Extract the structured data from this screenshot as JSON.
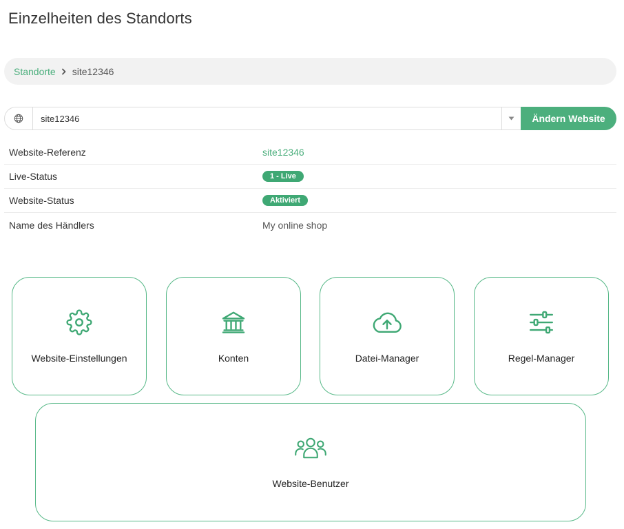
{
  "page": {
    "title": "Einzelheiten des Standorts"
  },
  "breadcrumb": {
    "parent": "Standorte",
    "current": "site12346"
  },
  "site_selector": {
    "value": "site12346",
    "button_label": "Ändern Website"
  },
  "details": {
    "reference": {
      "label": "Website-Referenz",
      "value": "site12346"
    },
    "live_status": {
      "label": "Live-Status",
      "value": "1 - Live"
    },
    "site_status": {
      "label": "Website-Status",
      "value": "Aktiviert"
    },
    "merchant_name": {
      "label": "Name des Händlers",
      "value": "My online shop"
    }
  },
  "tiles": {
    "settings": {
      "label": "Website-Einstellungen",
      "icon": "gear-icon"
    },
    "accounts": {
      "label": "Konten",
      "icon": "bank-icon"
    },
    "files": {
      "label": "Datei-Manager",
      "icon": "cloud-upload-icon"
    },
    "rules": {
      "label": "Regel-Manager",
      "icon": "sliders-icon"
    },
    "users": {
      "label": "Website-Benutzer",
      "icon": "users-icon"
    }
  },
  "colors": {
    "accent": "#4caf7d",
    "badge": "#3fa874",
    "breadcrumb_bg": "#f2f2f2"
  }
}
